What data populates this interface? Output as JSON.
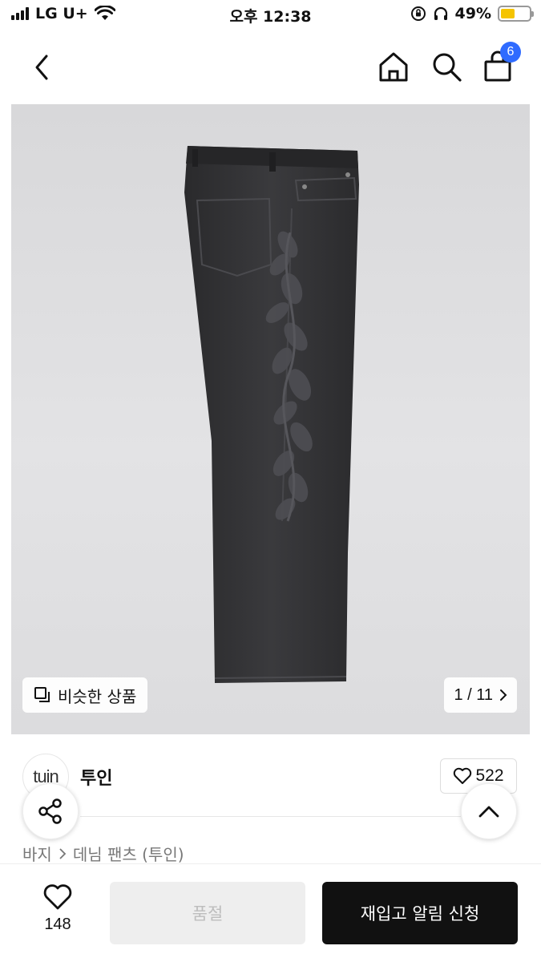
{
  "status_bar": {
    "carrier": "LG U+",
    "time": "오후 12:38",
    "battery": "49%",
    "battery_level": 0.49
  },
  "nav": {
    "back_icon": "chevron-left-icon",
    "home_icon": "home-icon",
    "search_icon": "search-icon",
    "cart_icon": "shopping-bag-icon",
    "cart_count": "6"
  },
  "image": {
    "similar_label": "비슷한 상품",
    "counter": "1 / 11"
  },
  "brand": {
    "logo_text": "tuin",
    "name": "투인",
    "like_count": "522"
  },
  "breadcrumb": {
    "category": "바지",
    "subcategory": "데님 팬츠 (투인)"
  },
  "bottom": {
    "wish_count": "148",
    "soldout_label": "품절",
    "restock_label": "재입고 알림 신청"
  },
  "colors": {
    "accent_badge": "#2f6bff",
    "primary_button": "#111111",
    "battery": "#f5c400"
  }
}
